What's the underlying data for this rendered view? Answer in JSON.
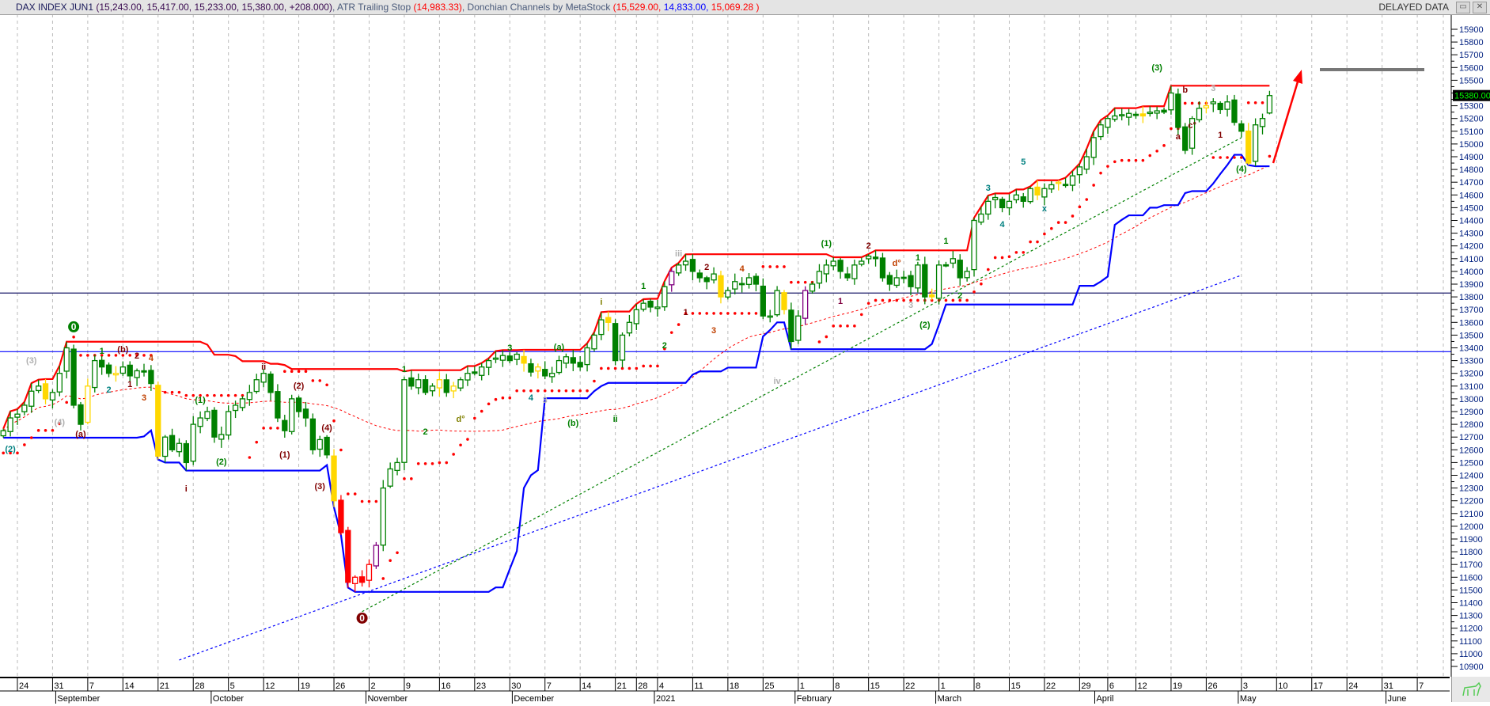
{
  "header": {
    "symbol": "DAX INDEX JUN1",
    "ohlc_text": "(15,243.00, 15,417.00, 15,233.00, 15,380.00, +208.000)",
    "atr_label": "ATR Trailing Stop",
    "atr_value": "(14,983.33)",
    "donchian_label": "Donchian Channels by MetaStock",
    "donchian_upper": "(15,529.00,",
    "donchian_lower": "14,833.00,",
    "donchian_mid": "15,069.28 )",
    "delayed": "DELAYED DATA",
    "restore_btn": "▭",
    "close_btn": "✕"
  },
  "colors": {
    "up": "#008000",
    "down": "#008000",
    "donchian_upper": "#ff0000",
    "donchian_lower": "#0000ff",
    "atr_dots": "#ff0000",
    "ma": "#ff0000",
    "level": "#0000ff",
    "level_top": "#1a1a6a",
    "trend_green": "#008000",
    "trend_blue": "#0000ff",
    "arrow": "#ff0000",
    "price_tag_bg": "#000000",
    "price_tag_fg": "#00ff00"
  },
  "chart_data": {
    "type": "candlestick",
    "y_range": [
      10900,
      15900
    ],
    "y_step": 100,
    "last_price": "15380.00",
    "last_bar": {
      "open": 15243,
      "high": 15417,
      "low": 15233,
      "close": 15380
    },
    "closes": [
      12750,
      12850,
      12880,
      12950,
      13060,
      13100,
      13000,
      13050,
      13200,
      13400,
      12950,
      12800,
      13100,
      13300,
      13250,
      13200,
      13200,
      13250,
      13180,
      13220,
      13210,
      13120,
      12550,
      12700,
      12600,
      12650,
      12500,
      12800,
      12850,
      12900,
      12700,
      12720,
      12900,
      12950,
      13000,
      13050,
      13150,
      13200,
      13050,
      12850,
      12750,
      13000,
      12900,
      12850,
      12600,
      12680,
      12560,
      12200,
      11950,
      11560,
      11600,
      11560,
      11700,
      11850,
      12300,
      12450,
      12500,
      13150,
      13100,
      13150,
      13050,
      13100,
      13150,
      13050,
      13100,
      13150,
      13200,
      13200,
      13250,
      13300,
      13320,
      13340,
      13300,
      13350,
      13280,
      13210,
      13250,
      13180,
      13200,
      13300,
      13330,
      13280,
      13250,
      13400,
      13500,
      13620,
      13600,
      13300,
      13500,
      13600,
      13700,
      13750,
      13720,
      13720,
      13880,
      14000,
      14050,
      14080,
      14000,
      13950,
      13920,
      13980,
      13800,
      13850,
      13920,
      13900,
      13950,
      13900,
      13650,
      13650,
      13850,
      13700,
      13450,
      13650,
      13850,
      13900,
      14000,
      14050,
      14080,
      14000,
      13950,
      14050,
      14080,
      14120,
      14100,
      13950,
      13900,
      13950,
      13950,
      13880,
      14050,
      13800,
      13800,
      14050,
      14050,
      14100,
      13950,
      14000,
      14400,
      14450,
      14550,
      14580,
      14500,
      14550,
      14600,
      14550,
      14650,
      14600,
      14650,
      14680,
      14700,
      14680,
      14750,
      14820,
      14900,
      15050,
      15150,
      15200,
      15220,
      15230,
      15240,
      15230,
      15220,
      15250,
      15260,
      15250,
      15400,
      15130,
      14950,
      15200,
      15280,
      15300,
      15330,
      15270,
      15330,
      15170,
      15100,
      14850,
      15150,
      15200,
      15380
    ],
    "color_overrides": {
      "6": "#ffd700",
      "12": "#ffd700",
      "16": "#ffd700",
      "22": "#ffd700",
      "47": "#ffd700",
      "48": "#ff0000",
      "49": "#ff0000",
      "50": "#ff0000",
      "51": "#ff0000",
      "52": "#ff0000",
      "53": "#800080",
      "62": "#ffd700",
      "64": "#ffd700",
      "74": "#ffd700",
      "76": "#ffd700",
      "86": "#ffd700",
      "95": "#800080",
      "102": "#ffd700",
      "111": "#ffd700",
      "114": "#800080",
      "132": "#ffd700",
      "147": "#ffd700",
      "150": "#ffd700",
      "162": "#ffd700",
      "171": "#ffd700",
      "177": "#ffd700"
    },
    "x_ticks": [
      {
        "label": "24",
        "idx": 2
      },
      {
        "label": "31",
        "idx": 7
      },
      {
        "label": "7",
        "idx": 12
      },
      {
        "label": "14",
        "idx": 17
      },
      {
        "label": "21",
        "idx": 22
      },
      {
        "label": "28",
        "idx": 27
      },
      {
        "label": "5",
        "idx": 32
      },
      {
        "label": "12",
        "idx": 37
      },
      {
        "label": "19",
        "idx": 42
      },
      {
        "label": "26",
        "idx": 47
      },
      {
        "label": "2",
        "idx": 52
      },
      {
        "label": "9",
        "idx": 57
      },
      {
        "label": "16",
        "idx": 62
      },
      {
        "label": "23",
        "idx": 67
      },
      {
        "label": "30",
        "idx": 72
      },
      {
        "label": "7",
        "idx": 77
      },
      {
        "label": "14",
        "idx": 82
      },
      {
        "label": "21",
        "idx": 87
      },
      {
        "label": "28",
        "idx": 90
      },
      {
        "label": "4",
        "idx": 93
      },
      {
        "label": "11",
        "idx": 98
      },
      {
        "label": "18",
        "idx": 103
      },
      {
        "label": "25",
        "idx": 108
      },
      {
        "label": "1",
        "idx": 113
      },
      {
        "label": "8",
        "idx": 118
      },
      {
        "label": "15",
        "idx": 123
      },
      {
        "label": "22",
        "idx": 128
      },
      {
        "label": "1",
        "idx": 133
      },
      {
        "label": "8",
        "idx": 138
      },
      {
        "label": "15",
        "idx": 143
      },
      {
        "label": "22",
        "idx": 148
      },
      {
        "label": "29",
        "idx": 153
      },
      {
        "label": "6",
        "idx": 157
      },
      {
        "label": "12",
        "idx": 161
      },
      {
        "label": "19",
        "idx": 166
      },
      {
        "label": "26",
        "idx": 171
      },
      {
        "label": "3",
        "idx": 176
      },
      {
        "label": "10",
        "idx": 181
      },
      {
        "label": "17",
        "idx": 186
      },
      {
        "label": "24",
        "idx": 191
      },
      {
        "label": "31",
        "idx": 196
      },
      {
        "label": "7",
        "idx": 201
      }
    ],
    "months": [
      {
        "label": "September",
        "idx": 7.9
      },
      {
        "label": "October",
        "idx": 30
      },
      {
        "label": "November",
        "idx": 52
      },
      {
        "label": "December",
        "idx": 72.8
      },
      {
        "label": "2021",
        "idx": 93
      },
      {
        "label": "February",
        "idx": 113
      },
      {
        "label": "March",
        "idx": 133
      },
      {
        "label": "April",
        "idx": 155.6
      },
      {
        "label": "May",
        "idx": 176
      },
      {
        "label": "June",
        "idx": 197
      }
    ],
    "levels": [
      13830,
      13370
    ],
    "trendlines": [
      {
        "name": "green",
        "from": [
          51,
          11330
        ],
        "to": [
          176,
          15050
        ]
      },
      {
        "name": "blue",
        "from": [
          25,
          10950
        ],
        "to": [
          176,
          13970
        ]
      }
    ],
    "wave_labels": [
      {
        "t": "(2)",
        "i": 1,
        "p": 12608,
        "c": "#008080"
      },
      {
        "t": "(3)",
        "i": 4,
        "p": 13304,
        "c": "#b0b0b0"
      },
      {
        "t": "(4)",
        "i": 8,
        "p": 12820,
        "c": "#b0b0b0"
      },
      {
        "t": "0",
        "i": 10,
        "p": 13565,
        "c": "#008000",
        "circle": true
      },
      {
        "t": "(a)",
        "i": 11,
        "p": 12726,
        "c": "#800000"
      },
      {
        "t": "1",
        "i": 14,
        "p": 13378,
        "c": "#008000"
      },
      {
        "t": "2",
        "i": 15,
        "p": 13074,
        "c": "#008080"
      },
      {
        "t": "(b)",
        "i": 17,
        "p": 13390,
        "c": "#800000"
      },
      {
        "t": "1",
        "i": 18,
        "p": 13117,
        "c": "#800000"
      },
      {
        "t": "2",
        "i": 19,
        "p": 13341,
        "c": "#800000"
      },
      {
        "t": "3",
        "i": 20,
        "p": 13012,
        "c": "#c04000"
      },
      {
        "t": "4",
        "i": 21,
        "p": 13322,
        "c": "#c04000"
      },
      {
        "t": "i",
        "i": 26,
        "p": 12298,
        "c": "#800000"
      },
      {
        "t": "(1)",
        "i": 28,
        "p": 12994,
        "c": "#008000"
      },
      {
        "t": "(2)",
        "i": 31,
        "p": 12509,
        "c": "#008000"
      },
      {
        "t": "ii",
        "i": 37,
        "p": 13255,
        "c": "#800000"
      },
      {
        "t": "(1)",
        "i": 40,
        "p": 12565,
        "c": "#800000"
      },
      {
        "t": "(2)",
        "i": 42,
        "p": 13105,
        "c": "#800000"
      },
      {
        "t": "(3)",
        "i": 45,
        "p": 12316,
        "c": "#800000"
      },
      {
        "t": "(4)",
        "i": 46,
        "p": 12776,
        "c": "#800000"
      },
      {
        "t": "0",
        "i": 51,
        "p": 11279,
        "c": "#800000",
        "circle": true
      },
      {
        "t": "1",
        "i": 57,
        "p": 13235,
        "c": "#008000"
      },
      {
        "t": "2",
        "i": 60,
        "p": 12745,
        "c": "#008000"
      },
      {
        "t": "d°",
        "i": 65,
        "p": 12845,
        "c": "#808000"
      },
      {
        "t": "3",
        "i": 72,
        "p": 13403,
        "c": "#008000"
      },
      {
        "t": "4",
        "i": 75,
        "p": 13012,
        "c": "#008080"
      },
      {
        "t": "3",
        "i": 77,
        "p": 12994,
        "c": "#b0b0b0"
      },
      {
        "t": "(a)",
        "i": 79,
        "p": 13410,
        "c": "#008000"
      },
      {
        "t": "(b)",
        "i": 81,
        "p": 12814,
        "c": "#008000"
      },
      {
        "t": "i",
        "i": 85,
        "p": 13764,
        "c": "#808000"
      },
      {
        "t": "ii",
        "i": 87,
        "p": 12845,
        "c": "#008000"
      },
      {
        "t": "1",
        "i": 91,
        "p": 13888,
        "c": "#008000"
      },
      {
        "t": "2",
        "i": 94,
        "p": 13422,
        "c": "#008000"
      },
      {
        "t": "iii",
        "i": 96,
        "p": 14142,
        "c": "#b0b0b0"
      },
      {
        "t": "1",
        "i": 97,
        "p": 13683,
        "c": "#800000"
      },
      {
        "t": "2",
        "i": 100,
        "p": 14037,
        "c": "#800000"
      },
      {
        "t": "3",
        "i": 101,
        "p": 13540,
        "c": "#c04000"
      },
      {
        "t": "4",
        "i": 105,
        "p": 14024,
        "c": "#c04000"
      },
      {
        "t": "iv",
        "i": 110,
        "p": 13143,
        "c": "#b0b0b0"
      },
      {
        "t": "(1)",
        "i": 117,
        "p": 14223,
        "c": "#008000"
      },
      {
        "t": "1",
        "i": 119,
        "p": 13770,
        "c": "#800040"
      },
      {
        "t": "2",
        "i": 123,
        "p": 14205,
        "c": "#800000"
      },
      {
        "t": "d°",
        "i": 127,
        "p": 14068,
        "c": "#c04000"
      },
      {
        "t": "3",
        "i": 129,
        "p": 13739,
        "c": "#b0b0b0"
      },
      {
        "t": "1",
        "i": 130,
        "p": 14111,
        "c": "#008000"
      },
      {
        "t": "(2)",
        "i": 131,
        "p": 13583,
        "c": "#008000"
      },
      {
        "t": "1",
        "i": 134,
        "p": 14241,
        "c": "#008000"
      },
      {
        "t": "2",
        "i": 136,
        "p": 13813,
        "c": "#008000"
      },
      {
        "t": "3",
        "i": 140,
        "p": 14658,
        "c": "#008080"
      },
      {
        "t": "4",
        "i": 142,
        "p": 14372,
        "c": "#008080"
      },
      {
        "t": "5",
        "i": 145,
        "p": 14863,
        "c": "#008080"
      },
      {
        "t": "x",
        "i": 148,
        "p": 14496,
        "c": "#008080"
      },
      {
        "t": "(3)",
        "i": 164,
        "p": 15602,
        "c": "#008000"
      },
      {
        "t": "a",
        "i": 167,
        "p": 15061,
        "c": "#800000"
      },
      {
        "t": "b",
        "i": 168,
        "p": 15428,
        "c": "#800000"
      },
      {
        "t": "c°",
        "i": 169,
        "p": 15148,
        "c": "#800000"
      },
      {
        "t": "3",
        "i": 172,
        "p": 15440,
        "c": "#b0b0b0"
      },
      {
        "t": "1",
        "i": 173,
        "p": 15074,
        "c": "#800000"
      },
      {
        "t": "(4)",
        "i": 176,
        "p": 14807,
        "c": "#008000"
      }
    ]
  }
}
